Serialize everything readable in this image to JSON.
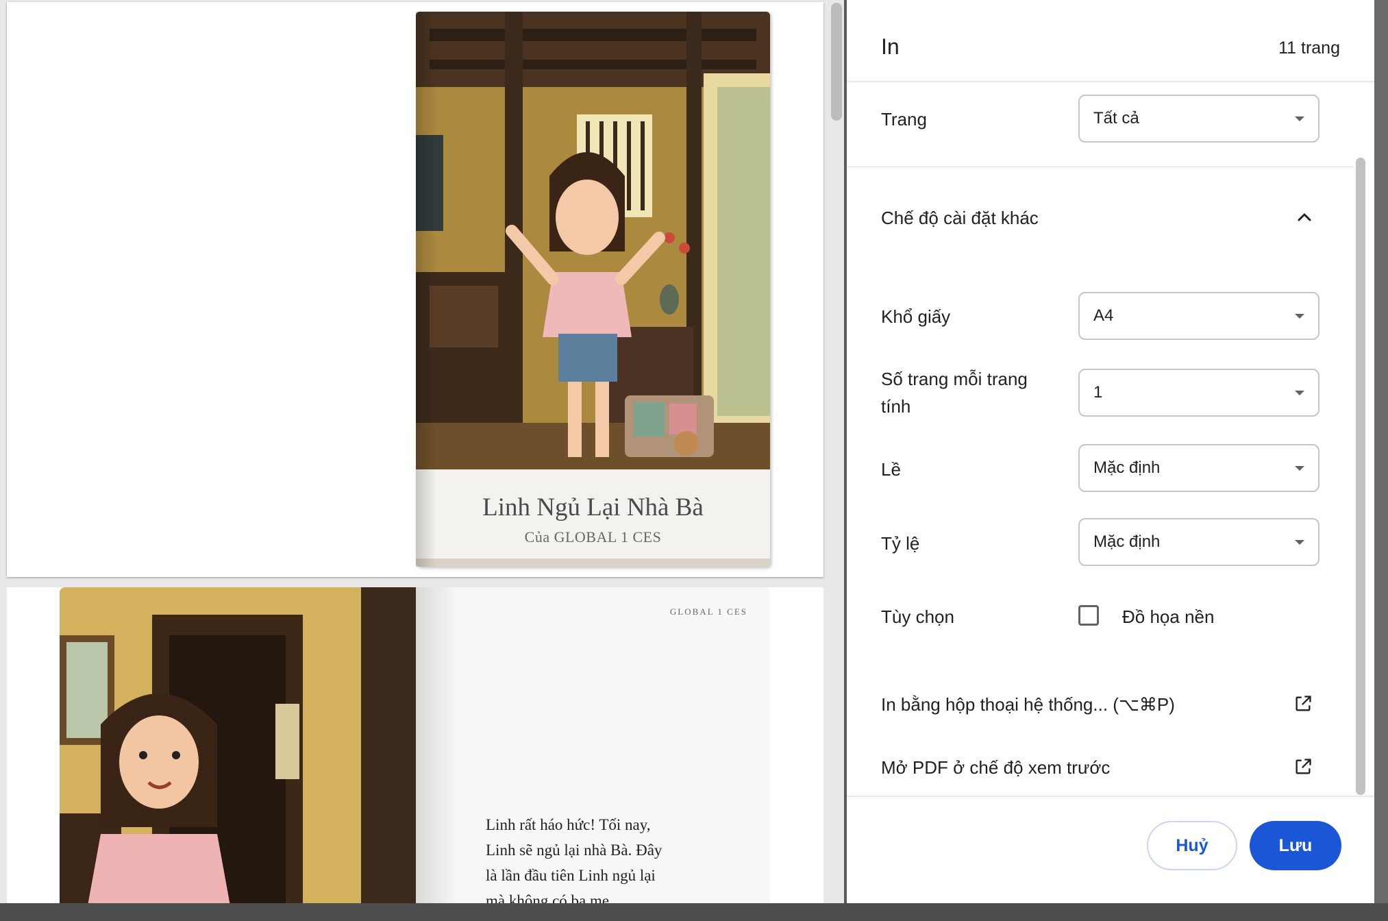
{
  "preview": {
    "cover": {
      "title": "Linh Ngủ Lại Nhà Bà",
      "author": "Của GLOBAL 1 CES"
    },
    "page2": {
      "running_head": "GLOBAL 1 CES",
      "story_lines": [
        "Linh rất háo hức! Tối nay,",
        "Linh sẽ ngủ lại nhà Bà. Đây",
        "là lần đầu tiên Linh ngủ lại",
        "mà không có ba mẹ."
      ]
    }
  },
  "dialog": {
    "title": "In",
    "page_count": "11 trang",
    "pages": {
      "label": "Trang",
      "value": "Tất cả"
    },
    "more_settings": {
      "label": "Chế độ cài đặt khác",
      "expanded": true
    },
    "paper_size": {
      "label": "Khổ giấy",
      "value": "A4"
    },
    "pages_per_sheet": {
      "label_line1": "Số trang mỗi trang",
      "label_line2": "tính",
      "value": "1"
    },
    "margins": {
      "label": "Lề",
      "value": "Mặc định"
    },
    "scale": {
      "label": "Tỷ lệ",
      "value": "Mặc định"
    },
    "options": {
      "label": "Tùy chọn",
      "background_graphics": "Đồ họa nền",
      "checked": false
    },
    "system_dialog": "In bằng hộp thoại hệ thống... (⌥⌘P)",
    "open_pdf_preview": "Mở PDF ở chế độ xem trước",
    "cancel_label": "Huỷ",
    "save_label": "Lưu"
  },
  "colors": {
    "accent": "#1a56d6"
  },
  "icons": [
    "chevron-up-icon",
    "external-link-icon",
    "dropdown-caret-icon",
    "checkbox"
  ]
}
